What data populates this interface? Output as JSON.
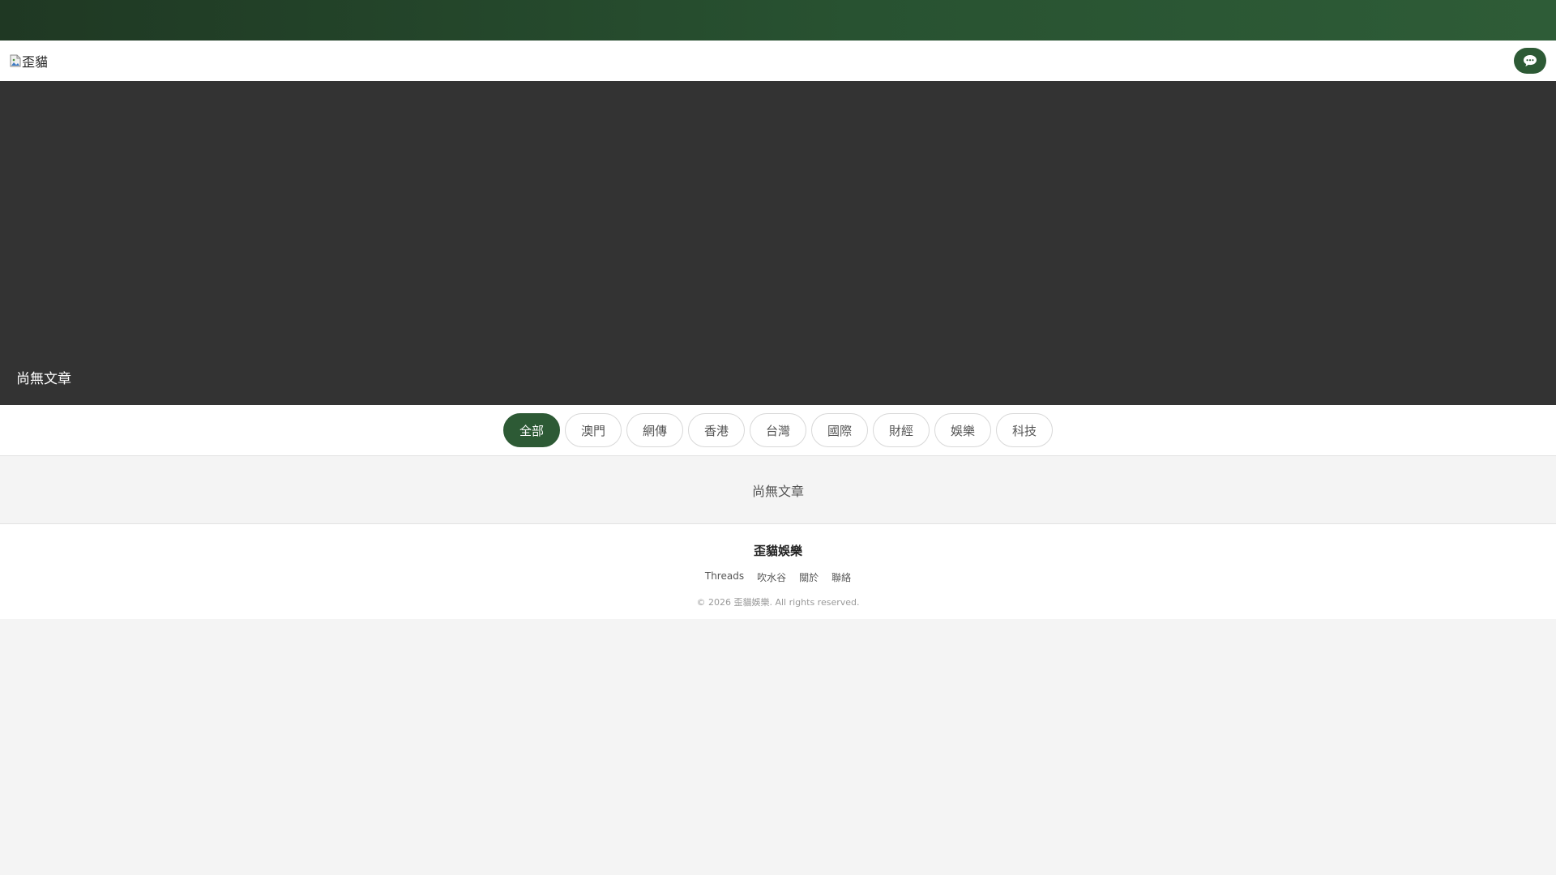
{
  "header": {
    "logo_alt": "歪貓",
    "chat_icon": "speech-bubble-icon"
  },
  "hero": {
    "empty_text": "尚無文章"
  },
  "categories": [
    {
      "label": "全部",
      "active": true
    },
    {
      "label": "澳門",
      "active": false
    },
    {
      "label": "網傳",
      "active": false
    },
    {
      "label": "香港",
      "active": false
    },
    {
      "label": "台灣",
      "active": false
    },
    {
      "label": "國際",
      "active": false
    },
    {
      "label": "財經",
      "active": false
    },
    {
      "label": "娛樂",
      "active": false
    },
    {
      "label": "科技",
      "active": false
    }
  ],
  "articles": {
    "empty_text": "尚無文章"
  },
  "footer": {
    "brand": "歪貓娛樂",
    "links": [
      "Threads",
      "吹水谷",
      "關於",
      "聯絡"
    ],
    "copyright": "© 2026 歪貓娛樂. All rights reserved."
  },
  "colors": {
    "brand_green": "#2d5a35",
    "hero_bg": "#333333",
    "page_bg": "#f4f4f4"
  }
}
